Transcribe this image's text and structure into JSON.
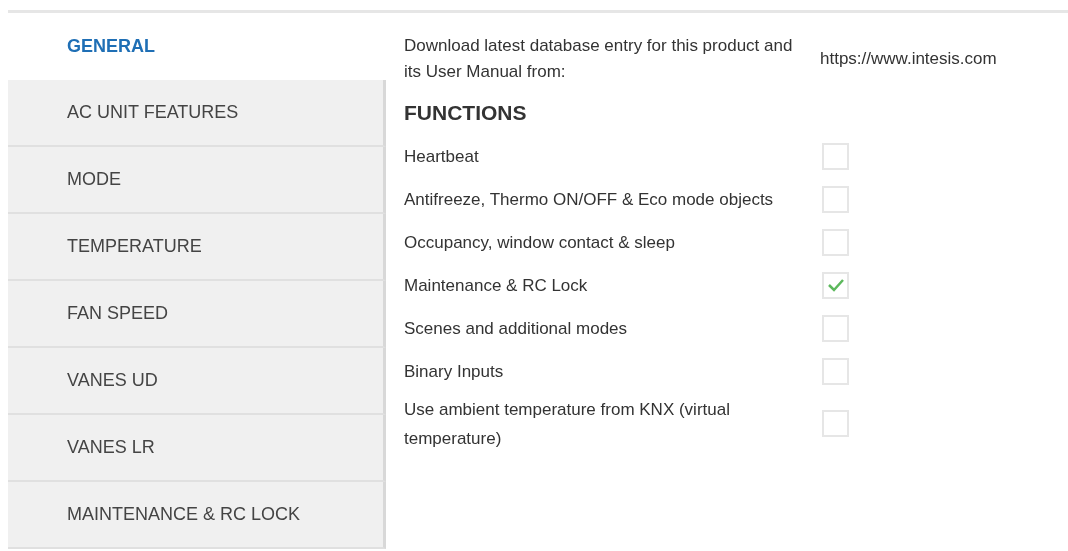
{
  "sidebar": {
    "items": [
      {
        "label": "GENERAL",
        "selected": true
      },
      {
        "label": "AC UNIT FEATURES",
        "selected": false
      },
      {
        "label": "MODE",
        "selected": false
      },
      {
        "label": "TEMPERATURE",
        "selected": false
      },
      {
        "label": "FAN SPEED",
        "selected": false
      },
      {
        "label": "VANES UD",
        "selected": false
      },
      {
        "label": "VANES LR",
        "selected": false
      },
      {
        "label": "MAINTENANCE & RC LOCK",
        "selected": false
      }
    ]
  },
  "download": {
    "text": "Download latest database entry for this product and its User Manual from:",
    "link": "https://www.intesis.com"
  },
  "functions": {
    "title": "FUNCTIONS",
    "items": [
      {
        "label": "Heartbeat",
        "checked": false
      },
      {
        "label": "Antifreeze, Thermo ON/OFF & Eco mode objects",
        "checked": false
      },
      {
        "label": "Occupancy, window contact & sleep",
        "checked": false
      },
      {
        "label": "Maintenance & RC Lock",
        "checked": true
      },
      {
        "label": "Scenes and additional modes",
        "checked": false
      },
      {
        "label": "Binary Inputs",
        "checked": false
      },
      {
        "label": "Use ambient temperature from KNX (virtual temperature)",
        "checked": false
      }
    ]
  }
}
